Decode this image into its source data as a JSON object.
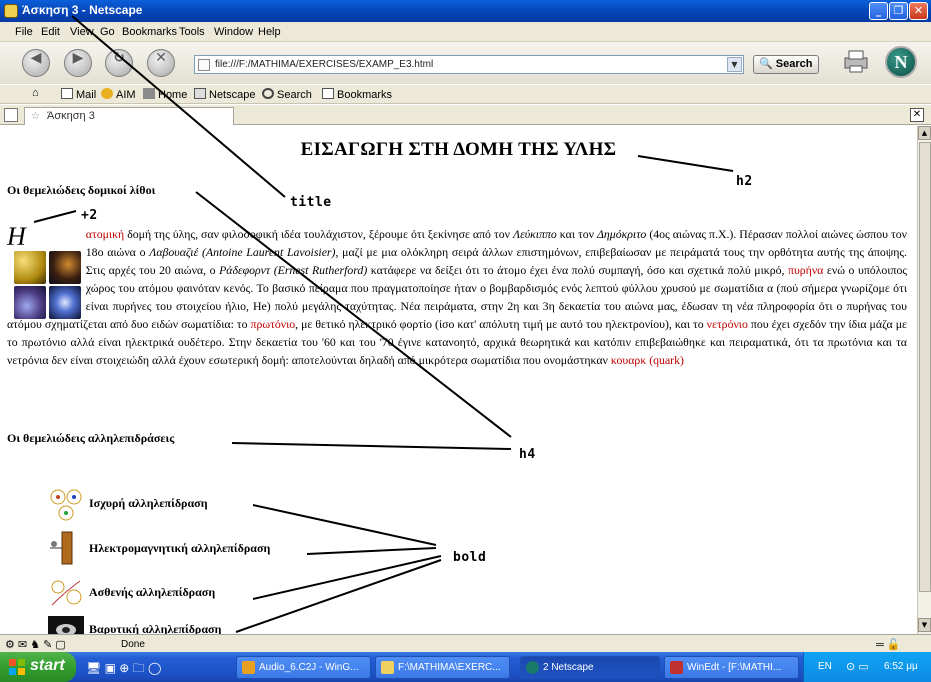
{
  "window": {
    "title": "Άσκηση 3 - Netscape",
    "controls": [
      "minimize",
      "maximize",
      "close"
    ]
  },
  "menu": [
    "File",
    "Edit",
    "View",
    "Go",
    "Bookmarks",
    "Tools",
    "Window",
    "Help"
  ],
  "nav": {
    "url": "file:///F:/MATHIMA/EXERCISES/EXAMP_E3.html",
    "search_label": "Search"
  },
  "personal_toolbar": [
    "Mail",
    "AIM",
    "Home",
    "Netscape",
    "Search",
    "Bookmarks"
  ],
  "tab": {
    "label": "Άσκηση 3"
  },
  "page": {
    "heading": "ΕΙΣΑΓΩΓΗ ΣΤΗ ΔΟΜΗ ΤΗΣ ΥΛΗΣ",
    "section1": "Οι θεμελιώδεις δομικοί λίθοι",
    "dropcap": "Η",
    "para": {
      "p01": " ",
      "atomic": "ατομική",
      "p02": " δομή της ύλης, σαν φιλοσοφική ιδέα τουλάχιστον, ξέρουμε ότι ξεκίνησε από τον ",
      "leucippus": "Λεύκιππο",
      "p03": " και τον ",
      "democritus": "Δημόκριτο",
      "p04": " (4ος αιώνας π.Χ.). Πέρασαν πολλοί αιώνες ώσπου τον 18ο αιώνα ο ",
      "lavoisier": "Λαβουαζιέ (Antoine Laurent Lavoisier)",
      "p05": ", μαζί με μια ολόκληρη σειρά άλλων επιστημόνων, επιβεβαίωσαν με πειράματά τους την ορθότητα αυτής της άποψης. Στις αρχές του 20 αιώνα, ο ",
      "rutherford": "Ράδεφορντ (Ernest Rutherford)",
      "p06": " κατάφερε να δείξει ότι το άτομο έχει ένα πολύ συμπαγή, όσο και σχετικά πολύ μικρό, ",
      "nucleus": "πυρήνα",
      "p07": " ενώ ο υπόλοιπος χώρος του ατόμου φαινόταν κενός. Το βασικό πείραμα που πραγματοποίησε ήταν ο βομβαρδισμός ενός λεπτού φύλλου χρυσού με σωματίδια α (πού σήμερα γνωρίζομε ότι είναι πυρήνες του στοιχείου ήλιο, He) πολύ μεγάλης ταχύτητας. Νέα πειράματα, στην 2η και 3η δεκαετία του αιώνα μας, έδωσαν τη νέα πληροφορία ότι ο πυρήνας του ατόμου σχηματίζεται από δυο ειδών σωματίδια: το ",
      "proton": "πρωτόνιο",
      "p08": ", με θετικό ηλεκτρικό φορτίο (ίσο κατ' απόλυτη τιμή με αυτό του ηλεκτρονίου), και το ",
      "neutron": "νετρόνιο",
      "p09": " που έχει σχεδόν την ίδια μάζα με το πρωτόνιο αλλά είναι ηλεκτρικά ουδέτερο. Στην δεκαετία του '60 και του '70 έγινε κατανοητό, αρχικά θεωρητικά και κατόπιν επιβεβαιώθηκε και πειραματικά, ότι τα πρωτόνια και τα νετρόνια δεν είναι στοιχειώδη αλλά έχουν εσωτερική δομή: αποτελούνται δηλαδή από μικρότερα σωματίδια που ονομάστηκαν ",
      "quark": "κουαρκ (quark)"
    },
    "section2": "Οι θεμελιώδεις αλληλεπιδράσεις",
    "forces": [
      "Ισχυρή αλληλεπίδραση",
      "Ηλεκτρομαγνητική αλληλεπίδραση",
      "Ασθενής αλληλεπίδραση",
      "Βαρυτική αλληλεπίδραση"
    ]
  },
  "annotations": {
    "h2": "h2",
    "title": "title",
    "plus2": "+2",
    "h4": "h4",
    "bold": "bold"
  },
  "status": {
    "text": "Done"
  },
  "taskbar": {
    "start": "start",
    "tasks": [
      "Audio_6.C2J - WinG...",
      "F:\\MATHIMA\\EXERC...",
      "2 Netscape",
      "WinEdt - [F:\\MATHI..."
    ],
    "lang": "EN",
    "clock": "6:52 μμ"
  },
  "colors": {
    "link_red": "#c00000",
    "titlebar_blue": "#0645b8",
    "taskbar_blue": "#245ed6"
  }
}
